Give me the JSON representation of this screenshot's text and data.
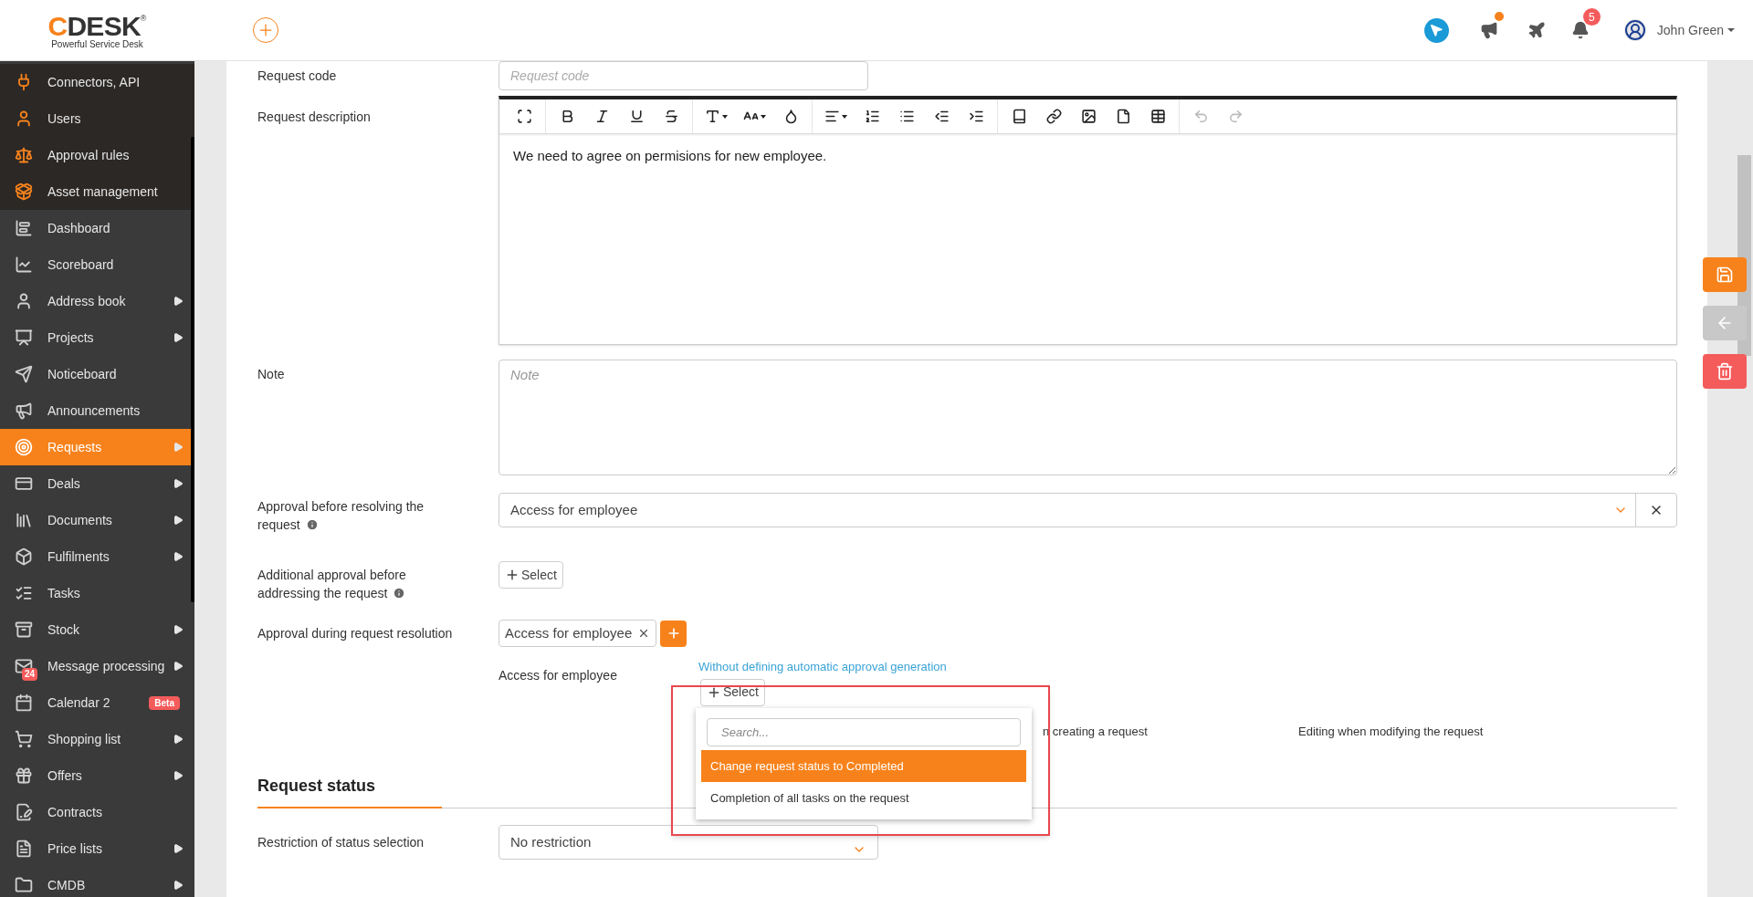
{
  "header": {
    "logo": {
      "name": "CDESK",
      "mark": "®",
      "tagline": "Powerful Service Desk"
    },
    "announcements_unread": true,
    "notifications_badge": "5",
    "user_name": "John Green"
  },
  "sidebar": {
    "items": [
      {
        "label": "Connectors, API",
        "pinned": true,
        "selected": false,
        "submenu": false
      },
      {
        "label": "Users",
        "pinned": true,
        "selected": false,
        "submenu": false
      },
      {
        "label": "Approval rules",
        "pinned": true,
        "selected": false,
        "submenu": false
      },
      {
        "label": "Asset management",
        "pinned": true,
        "selected": false,
        "submenu": false
      },
      {
        "label": "Dashboard",
        "pinned": false,
        "selected": false,
        "submenu": false
      },
      {
        "label": "Scoreboard",
        "pinned": false,
        "selected": false,
        "submenu": false
      },
      {
        "label": "Address book",
        "pinned": false,
        "selected": false,
        "submenu": true
      },
      {
        "label": "Projects",
        "pinned": false,
        "selected": false,
        "submenu": true
      },
      {
        "label": "Noticeboard",
        "pinned": false,
        "selected": false,
        "submenu": false
      },
      {
        "label": "Announcements",
        "pinned": false,
        "selected": false,
        "submenu": false
      },
      {
        "label": "Requests",
        "pinned": false,
        "selected": true,
        "submenu": true
      },
      {
        "label": "Deals",
        "pinned": false,
        "selected": false,
        "submenu": true
      },
      {
        "label": "Documents",
        "pinned": false,
        "selected": false,
        "submenu": true
      },
      {
        "label": "Fulfilments",
        "pinned": false,
        "selected": false,
        "submenu": true
      },
      {
        "label": "Tasks",
        "pinned": false,
        "selected": false,
        "submenu": false
      },
      {
        "label": "Stock",
        "pinned": false,
        "selected": false,
        "submenu": true
      },
      {
        "label": "Message processing",
        "pinned": false,
        "selected": false,
        "submenu": true,
        "badge": "24"
      },
      {
        "label": "Calendar 2",
        "pinned": false,
        "selected": false,
        "submenu": false,
        "tag": "Beta"
      },
      {
        "label": "Shopping list",
        "pinned": false,
        "selected": false,
        "submenu": true
      },
      {
        "label": "Offers",
        "pinned": false,
        "selected": false,
        "submenu": true
      },
      {
        "label": "Contracts",
        "pinned": false,
        "selected": false,
        "submenu": false
      },
      {
        "label": "Price lists",
        "pinned": false,
        "selected": false,
        "submenu": true
      },
      {
        "label": "CMDB",
        "pinned": false,
        "selected": false,
        "submenu": true
      }
    ]
  },
  "form": {
    "request_code": {
      "label": "Request code",
      "placeholder": "Request code"
    },
    "description": {
      "label": "Request description",
      "text": "We need to agree on permisions for new employee."
    },
    "note": {
      "label": "Note",
      "placeholder": "Note"
    },
    "approval_before_resolving": {
      "label": "Approval before resolving the request",
      "info": true,
      "value": "Access for employee"
    },
    "additional_approval": {
      "label": "Additional approval before addressing the request",
      "info": true,
      "button": "Select"
    },
    "approval_during": {
      "label": "Approval during request resolution",
      "tags": [
        "Access for employee"
      ],
      "item_name": "Access for employee",
      "link": "Without defining automatic approval generation",
      "button": "Select",
      "columns": [
        "n creating a request",
        "Editing when modifying the request"
      ]
    },
    "section_title": "Request status",
    "status_restriction": {
      "label": "Restriction of status selection",
      "value": "No restriction"
    }
  },
  "dropdown": {
    "search_placeholder": "Search...",
    "options": [
      {
        "label": "Change request status to Completed",
        "selected": true
      },
      {
        "label": "Completion of all tasks on the request",
        "selected": false
      }
    ]
  }
}
